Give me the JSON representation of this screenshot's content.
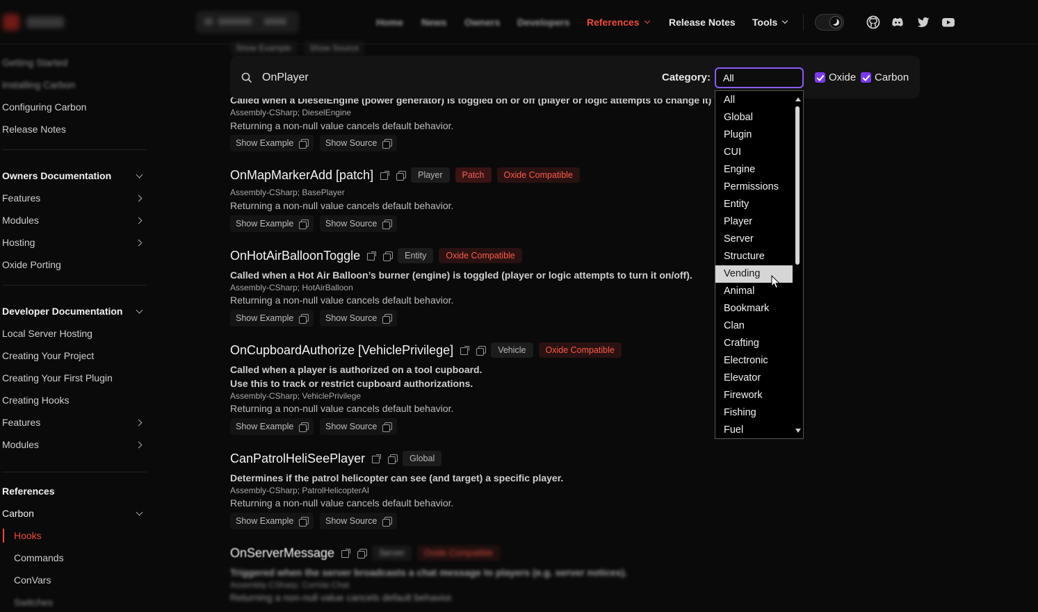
{
  "nav": {
    "items": [
      "Home",
      "News",
      "Owners",
      "Developers"
    ],
    "references": "References",
    "release_notes": "Release Notes",
    "tools": "Tools"
  },
  "sidebar": {
    "intro_items": [
      "Getting Started",
      "Installing Carbon",
      "Configuring Carbon",
      "Release Notes"
    ],
    "owners_head": "Owners Documentation",
    "owners_items": [
      "Features",
      "Modules",
      "Hosting",
      "Oxide Porting"
    ],
    "dev_head": "Developer Documentation",
    "dev_items": [
      "Local Server Hosting",
      "Creating Your Project",
      "Creating Your First Plugin",
      "Creating Hooks",
      "Features",
      "Modules"
    ],
    "refs_head": "References",
    "carbon": "Carbon",
    "carbon_items": [
      "Hooks",
      "Commands",
      "ConVars",
      "Switches"
    ]
  },
  "filter": {
    "search_value": "OnPlayer",
    "category_label": "Category:",
    "category_selected": "All",
    "oxide_label": "Oxide",
    "carbon_label": "Carbon",
    "options": [
      "All",
      "Global",
      "Plugin",
      "CUI",
      "Engine",
      "Permissions",
      "Entity",
      "Player",
      "Server",
      "Structure",
      "Vending",
      "Animal",
      "Bookmark",
      "Clan",
      "Crafting",
      "Electronic",
      "Elevator",
      "Firework",
      "Fishing",
      "Fuel"
    ],
    "hovered_option": "Vending"
  },
  "ghost_buttons": [
    "Show Example",
    "Show Source"
  ],
  "hooks": [
    {
      "title": "",
      "desc": "Called when a DieselEngine (power generator) is toggled on or off (player or logic attempts to change it).",
      "asm": "Assembly-CSharp; DieselEngine",
      "ret": "Returning a non-null value cancels default behavior.",
      "show_example": "Show Example",
      "show_source": "Show Source"
    },
    {
      "title": "OnMapMarkerAdd [patch]",
      "tags": [
        "Player",
        "Patch",
        "Oxide Compatible"
      ],
      "asm": "Assembly-CSharp; BasePlayer",
      "ret": "Returning a non-null value cancels default behavior.",
      "show_example": "Show Example",
      "show_source": "Show Source"
    },
    {
      "title": "OnHotAirBalloonToggle",
      "tags": [
        "Entity",
        "Oxide Compatible"
      ],
      "desc": "Called when a Hot Air Balloon’s burner (engine) is toggled (player or logic attempts to turn it on/off).",
      "asm": "Assembly-CSharp; HotAirBalloon",
      "ret": "Returning a non-null value cancels default behavior.",
      "show_example": "Show Example",
      "show_source": "Show Source"
    },
    {
      "title": "OnCupboardAuthorize [VehiclePrivilege]",
      "tags": [
        "Vehicle",
        "Oxide Compatible"
      ],
      "desc": "Called when a player is authorized on a tool cupboard.",
      "desc2": "Use this to track or restrict cupboard authorizations.",
      "asm": "Assembly-CSharp; VehiclePrivilege",
      "ret": "Returning a non-null value cancels default behavior.",
      "show_example": "Show Example",
      "show_source": "Show Source"
    },
    {
      "title": "CanPatrolHeliSeePlayer",
      "tags": [
        "Global"
      ],
      "desc": "Determines if the patrol helicopter can see (and target) a specific player.",
      "asm": "Assembly-CSharp; PatrolHelicopterAI",
      "ret": "Returning a non-null value cancels default behavior.",
      "show_example": "Show Example",
      "show_source": "Show Source"
    },
    {
      "title": "OnServerMessage",
      "tags": [
        "Server",
        "Oxide Compatible"
      ],
      "desc": "Triggered when the server broadcasts a chat message to players (e.g. server notices).",
      "asm": "Assembly-CSharp; ConVar.Chat",
      "ret": "Returning a non-null value cancels default behavior."
    }
  ],
  "colors": {
    "accent": "#ef4b3b",
    "focus": "#8b5cf6",
    "checkbox": "#7c3aed"
  }
}
